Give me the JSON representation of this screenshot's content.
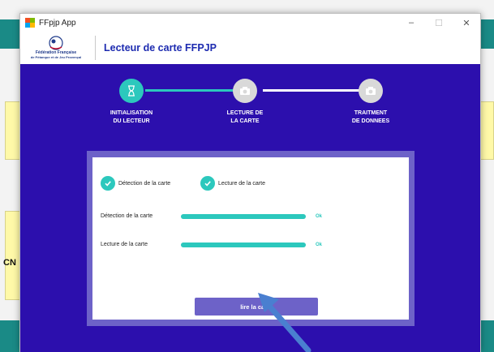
{
  "window": {
    "title": "FFpjp App"
  },
  "window_controls": {
    "minimize": "–",
    "maximize": "☐",
    "close": "✕"
  },
  "header": {
    "title": "Lecteur de carte FFPJP",
    "logo_text_line1": "Fédération Française",
    "logo_text_line2": "de Pétanque et de Jeu Provençal"
  },
  "steps": [
    {
      "label": "INITIALISATION\nDU LECTEUR",
      "state": "done",
      "icon": "hourglass-icon"
    },
    {
      "label": "LECTURE DE\nLA CARTE",
      "state": "todo",
      "icon": "camera-icon"
    },
    {
      "label": "TRAITMENT\nDE DONNEES",
      "state": "todo",
      "icon": "camera-icon"
    }
  ],
  "checks": [
    {
      "label": "Détection de la carte",
      "checked": true
    },
    {
      "label": "Lecture de la carte",
      "checked": true
    }
  ],
  "progress": [
    {
      "label": "Détection de la carte",
      "value": 1.0,
      "status": "Ok"
    },
    {
      "label": "Lecture de la carte",
      "value": 1.0,
      "status": "Ok"
    }
  ],
  "read_button": {
    "label": "lire la carte"
  },
  "background": {
    "cn_text": "CN"
  },
  "colors": {
    "primary": "#2c0fad",
    "accent": "#2cc8bd",
    "panel_border": "#6d62c8",
    "title": "#1d2bb0"
  }
}
